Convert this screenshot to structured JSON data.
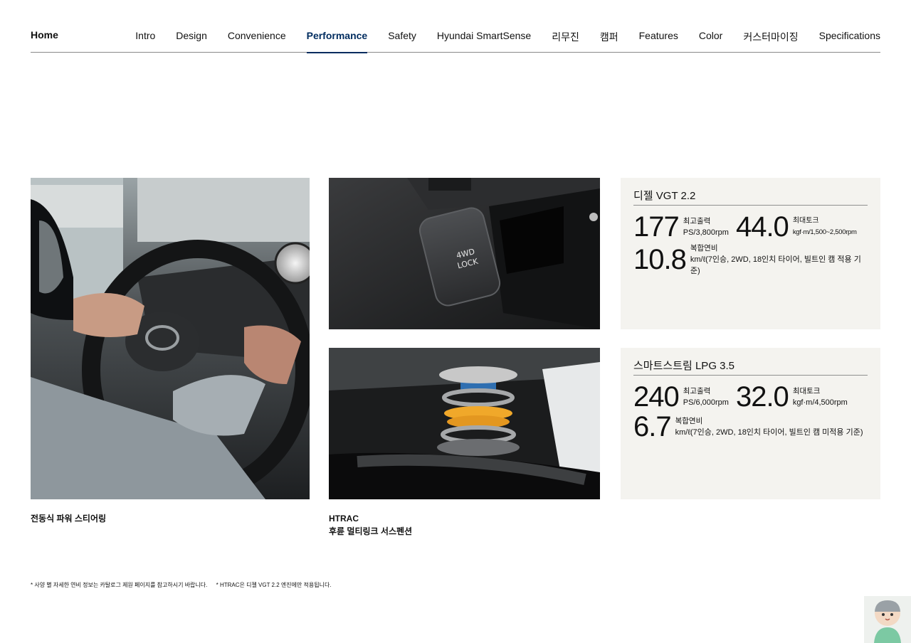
{
  "nav": {
    "home": "Home",
    "tabs": [
      {
        "label": "Intro"
      },
      {
        "label": "Design"
      },
      {
        "label": "Convenience"
      },
      {
        "label": "Performance",
        "active": true
      },
      {
        "label": "Safety"
      },
      {
        "label": "Hyundai SmartSense"
      },
      {
        "label": "리무진"
      },
      {
        "label": "캠퍼"
      },
      {
        "label": "Features"
      },
      {
        "label": "Color"
      },
      {
        "label": "커스터마이징"
      },
      {
        "label": "Specifications"
      }
    ],
    "accent_color": "#002c5f"
  },
  "photos": {
    "steering_caption": "전동식 파워 스티어링",
    "htrac_caption_line1": "HTRAC",
    "htrac_caption_line2": "후륜 멀티링크 서스펜션",
    "button_text_line1": "4WD",
    "button_text_line2": "LOCK"
  },
  "specs": [
    {
      "title": "디젤 VGT 2.2",
      "power_value": "177",
      "power_label": "최고출력",
      "power_unit": "PS/3,800rpm",
      "torque_value": "44.0",
      "torque_label": "최대토크",
      "torque_unit": "kgf·m/1,500~2,500rpm",
      "fuel_value": "10.8",
      "fuel_label": "복합연비",
      "fuel_unit": "km/ℓ(7인승, 2WD, 18인치 타이어, 빌트인 캠 적용 기준)"
    },
    {
      "title": "스마트스트림 LPG 3.5",
      "power_value": "240",
      "power_label": "최고출력",
      "power_unit": "PS/6,000rpm",
      "torque_value": "32.0",
      "torque_label": "최대토크",
      "torque_unit": "kgf·m/4,500rpm",
      "fuel_value": "6.7",
      "fuel_label": "복합연비",
      "fuel_unit": "km/ℓ(7인승, 2WD, 18인치 타이어, 빌트인 캠 미적용 기준)"
    }
  ],
  "footnotes": [
    "* 사양 별 자세한 연비 정보는 카탈로그 제원 페이지를 참고하시기 바랍니다.",
    "* HTRAC은 디젤 VGT 2.2 엔진에만 적용됩니다."
  ]
}
